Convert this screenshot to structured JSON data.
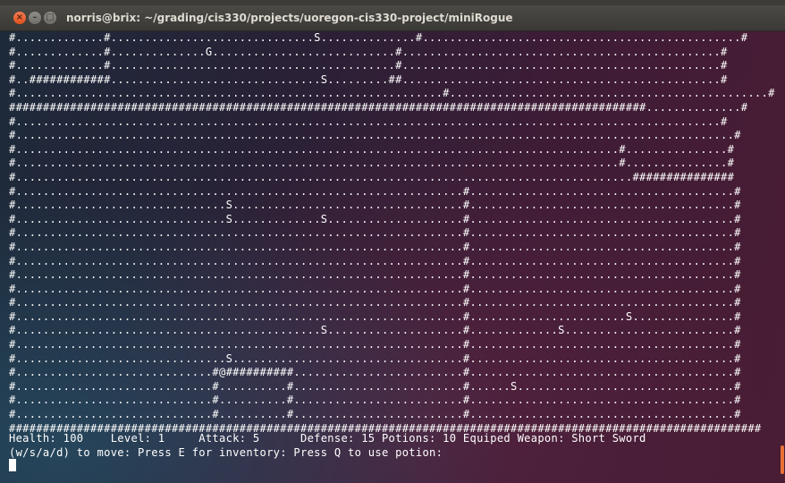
{
  "window": {
    "title": "norris@brix: ~/grading/cis330/projects/uoregon-cis330-project/miniRogue",
    "close_glyph": "×",
    "minimize_glyph": "–",
    "maximize_glyph": "□"
  },
  "map": {
    "rows": [
      "#.............#..............................S..............#...............................................#",
      "#.............#..............G...........................#...............................................#",
      "#.............#..........................................#...............................................#",
      "#..############...............................S.........##...............................................#",
      "#...............................................................#...............................................#",
      "##############################################################################################..............#",
      "#........................................................................................................#",
      "#..........................................................................................................#",
      "#.........................................................................................#...............#",
      "#.........................................................................................#...............#",
      "#...........................................................................................###############",
      "#..................................................................#.......................................#",
      "#...............................S..................................#.......................................#",
      "#...............................S.............S....................#.......................................#",
      "#..................................................................#.......................................#",
      "#..................................................................#.......................................#",
      "#..................................................................#.......................................#",
      "#..................................................................#.......................................#",
      "#..................................................................#.......................................#",
      "#..................................................................#.......................................#",
      "#..................................................................#.......................S...............#",
      "#.............................................S....................#.............S.........................#",
      "#..................................................................#.......................................#",
      "#...............................S..................................#.......................................#",
      "#.............................#@##########.........................#.......................................#",
      "#.............................#..........#.........................#......S................................#",
      "#.............................#..........#.........................#.......................................#",
      "#.............................#..........#.........................#.......................................#",
      "###############################################################################################################"
    ]
  },
  "status": {
    "stats_line": "Health: 100    Level: 1     Attack: 5      Defense: 15 Potions: 10 Equiped Weapon: Short Sword",
    "help_line": "(w/s/a/d) to move: Press E for inventory: Press Q to use potion:"
  },
  "colors": {
    "terminal_text": "#ffffff",
    "titlebar": "#3c3b37",
    "close_button": "#e0521e",
    "scroll_indicator": "#e8713a"
  }
}
